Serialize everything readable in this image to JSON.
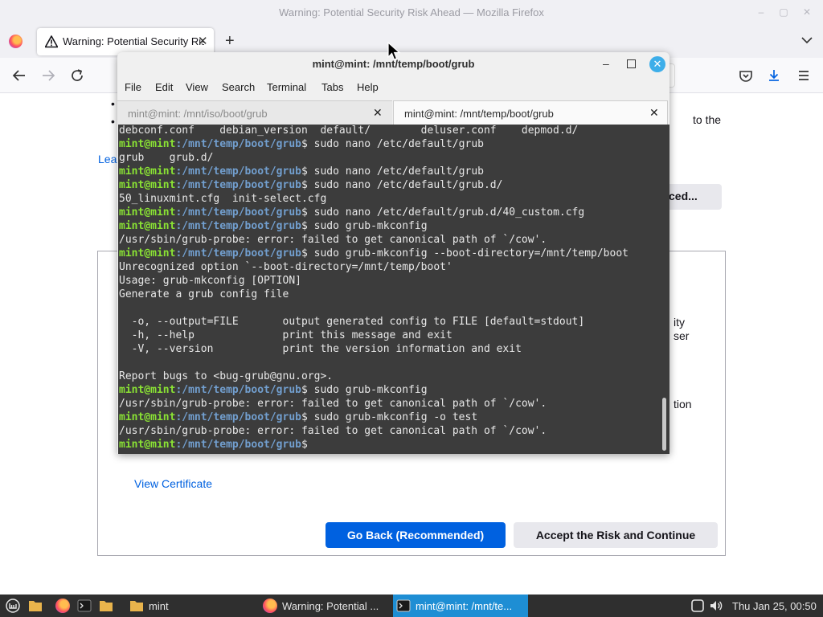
{
  "firefox": {
    "window_title": "Warning: Potential Security Risk Ahead — Mozilla Firefox",
    "tab_label": "Warning: Potential Security Risk Ahead",
    "page": {
      "fragment_right_1": "to the",
      "fragment_learn": "Lea",
      "advanced_button_label": "ced...",
      "fragment_right_2": "ity",
      "fragment_right_3": "ser",
      "fragment_right_4": "tion",
      "view_certificate": "View Certificate",
      "go_back_button": "Go Back (Recommended)",
      "accept_button": "Accept the Risk and Continue"
    }
  },
  "terminal": {
    "title": "mint@mint: /mnt/temp/boot/grub",
    "menu": [
      "File",
      "Edit",
      "View",
      "Search",
      "Terminal",
      "Tabs",
      "Help"
    ],
    "tabs": [
      {
        "label": "mint@mint: /mnt/iso/boot/grub",
        "active": false
      },
      {
        "label": "mint@mint: /mnt/temp/boot/grub",
        "active": true
      }
    ],
    "prompt_user": "mint@mint",
    "prompt_path": ":/mnt/temp/boot/grub",
    "lines": [
      {
        "kind": "out",
        "text": "debconf.conf    debian_version  default/        deluser.conf    depmod.d/"
      },
      {
        "kind": "cmd",
        "text": "$ sudo nano /etc/default/grub"
      },
      {
        "kind": "out",
        "text": "grub    grub.d/"
      },
      {
        "kind": "cmd",
        "text": "$ sudo nano /etc/default/grub"
      },
      {
        "kind": "cmd",
        "text": "$ sudo nano /etc/default/grub.d/"
      },
      {
        "kind": "out",
        "text": "50_linuxmint.cfg  init-select.cfg"
      },
      {
        "kind": "cmd",
        "text": "$ sudo nano /etc/default/grub.d/40_custom.cfg"
      },
      {
        "kind": "cmd",
        "text": "$ sudo grub-mkconfig"
      },
      {
        "kind": "out",
        "text": "/usr/sbin/grub-probe: error: failed to get canonical path of `/cow'."
      },
      {
        "kind": "cmd",
        "text": "$ sudo grub-mkconfig --boot-directory=/mnt/temp/boot"
      },
      {
        "kind": "out",
        "text": "Unrecognized option `--boot-directory=/mnt/temp/boot'"
      },
      {
        "kind": "out",
        "text": "Usage: grub-mkconfig [OPTION]"
      },
      {
        "kind": "out",
        "text": "Generate a grub config file"
      },
      {
        "kind": "out",
        "text": ""
      },
      {
        "kind": "out",
        "text": "  -o, --output=FILE       output generated config to FILE [default=stdout]"
      },
      {
        "kind": "out",
        "text": "  -h, --help              print this message and exit"
      },
      {
        "kind": "out",
        "text": "  -V, --version           print the version information and exit"
      },
      {
        "kind": "out",
        "text": ""
      },
      {
        "kind": "out",
        "text": "Report bugs to <bug-grub@gnu.org>."
      },
      {
        "kind": "cmd",
        "text": "$ sudo grub-mkconfig"
      },
      {
        "kind": "out",
        "text": "/usr/sbin/grub-probe: error: failed to get canonical path of `/cow'."
      },
      {
        "kind": "cmd",
        "text": "$ sudo grub-mkconfig -o test"
      },
      {
        "kind": "out",
        "text": "/usr/sbin/grub-probe: error: failed to get canonical path of `/cow'."
      },
      {
        "kind": "cmd",
        "text": "$ "
      }
    ]
  },
  "taskbar": {
    "folder_label": "mint",
    "firefox_label": "Warning: Potential ...",
    "terminal_label": "mint@mint: /mnt/te...",
    "clock": "Thu Jan 25, 00:50"
  },
  "colors": {
    "accent_blue": "#0061e0",
    "terminal_bg": "#3c3c3c",
    "prompt_user": "#8ae234",
    "prompt_path": "#729fcf",
    "taskbar_bg": "#2f2f2f",
    "taskbar_active": "#1e8ed4"
  },
  "icons": {
    "browser_tab": "warning-triangle-icon",
    "nav": [
      "back-arrow-icon",
      "forward-arrow-icon",
      "reload-icon",
      "pocket-icon",
      "downloads-icon",
      "menu-icon"
    ],
    "taskbar": [
      "mint-menu-icon",
      "folder-icon",
      "firefox-icon",
      "terminal-icon",
      "files-icon",
      "shield-icon",
      "volume-icon"
    ]
  }
}
